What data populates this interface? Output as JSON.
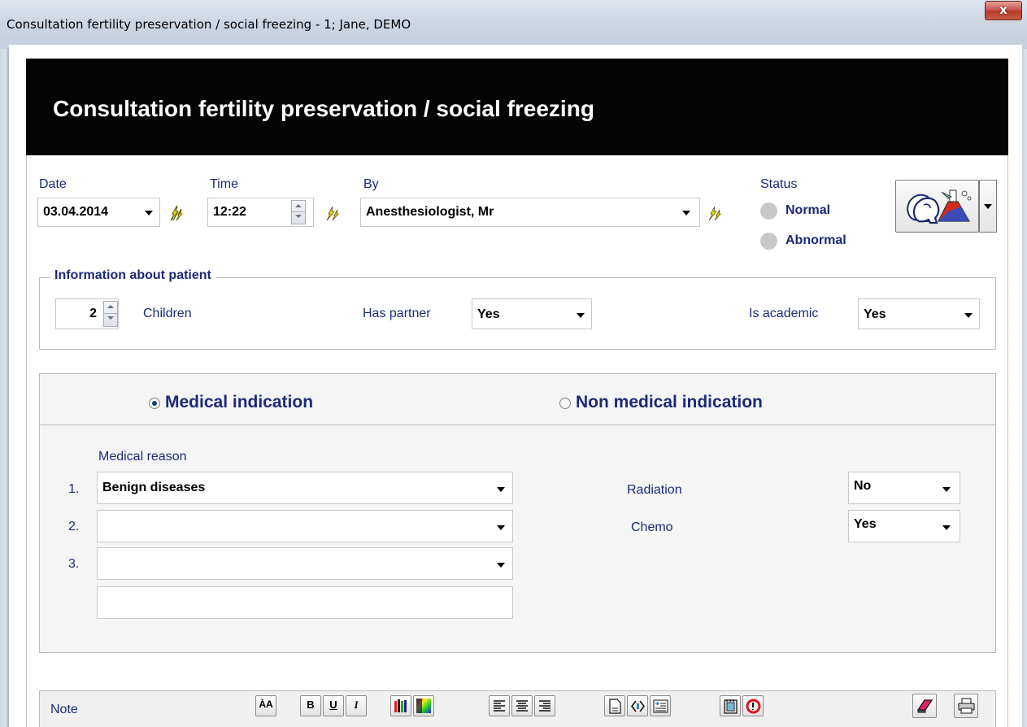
{
  "window": {
    "title": "Consultation fertility preservation / social freezing - 1; Jane, DEMO",
    "close_label": "x"
  },
  "header": {
    "title": "Consultation fertility preservation / social freezing"
  },
  "fields": {
    "date": {
      "label": "Date",
      "value": "03.04.2014"
    },
    "time": {
      "label": "Time",
      "value": "12:22"
    },
    "by": {
      "label": "By",
      "value": "Anesthesiologist, Mr"
    },
    "status": {
      "label": "Status",
      "options": [
        "Normal",
        "Abnormal"
      ],
      "selected": null
    }
  },
  "patient_info": {
    "legend": "Information about patient",
    "children_count": "2",
    "children_label": "Children",
    "has_partner_label": "Has partner",
    "has_partner_value": "Yes",
    "is_academic_label": "Is academic",
    "is_academic_value": "Yes"
  },
  "indication": {
    "medical_label": "Medical indication",
    "non_medical_label": "Non medical indication",
    "selected": "medical",
    "reason_label": "Medical reason",
    "reasons": [
      {
        "num": "1.",
        "value": "Benign diseases"
      },
      {
        "num": "2.",
        "value": ""
      },
      {
        "num": "3.",
        "value": ""
      }
    ],
    "reason_extra": "",
    "radiation_label": "Radiation",
    "radiation_value": "No",
    "chemo_label": "Chemo",
    "chemo_value": "Yes"
  },
  "note": {
    "label": "Note",
    "toolbar_icons": [
      "font-size-icon",
      "bold-icon",
      "underline-icon",
      "italic-icon",
      "text-color-icon",
      "background-color-icon",
      "align-left-icon",
      "align-center-icon",
      "align-right-icon",
      "page-icon",
      "indent-icon",
      "outdent-icon",
      "template-icon",
      "refresh-icon",
      "eraser-icon",
      "print-icon"
    ],
    "bold_glyph": "B",
    "underline_glyph": "U",
    "italic_glyph": "I"
  },
  "colors": {
    "header_bg": "#050404",
    "label_blue": "#1b2a78",
    "bolt_yellow": "#f2e600"
  }
}
